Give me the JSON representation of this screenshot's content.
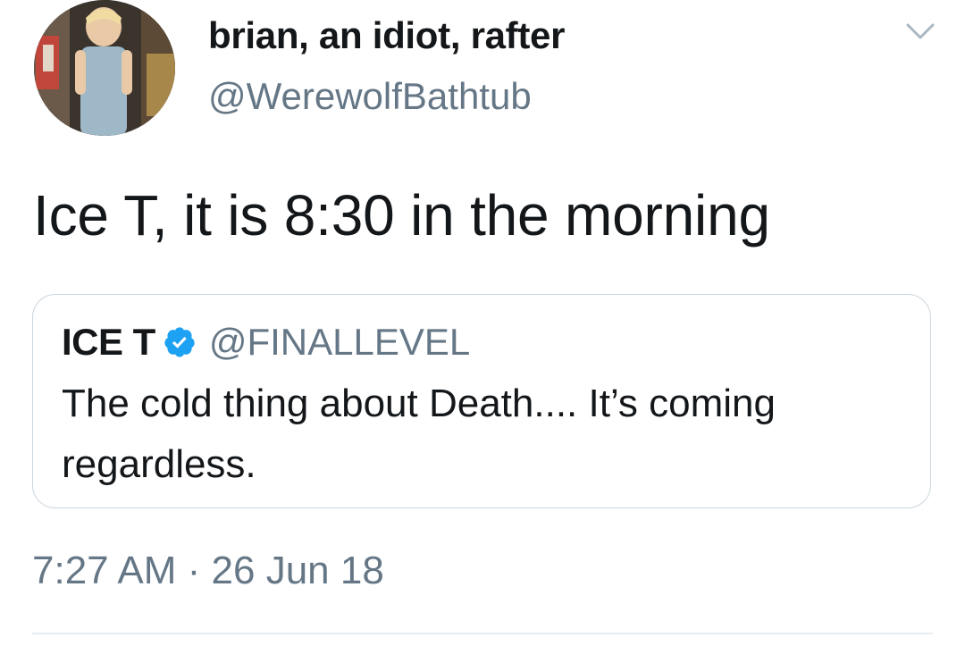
{
  "tweet": {
    "author": {
      "display_name": "brian, an idiot, rafter",
      "handle": "@WerewolfBathtub"
    },
    "text": "Ice T, it is 8:30 in the morning",
    "timestamp": "7:27 AM · 26 Jun 18",
    "menu_icon": "chevron-down-icon"
  },
  "quoted_tweet": {
    "display_name": "ICE T",
    "verified_icon": "verified-badge-icon",
    "handle": "@FINALLEVEL",
    "text": "The cold thing about Death.... It’s coming regardless."
  },
  "colors": {
    "text_primary": "#14171a",
    "text_secondary": "#657786",
    "border": "#ccd6dd",
    "verified_blue": "#1da1f2"
  }
}
